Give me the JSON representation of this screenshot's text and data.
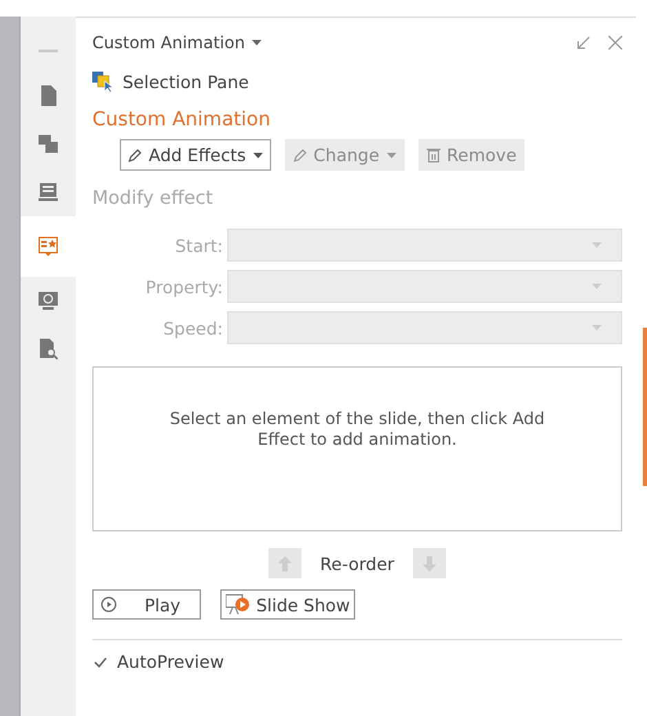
{
  "sidebar": {
    "items": [
      {
        "kind": "menu",
        "selected": false
      },
      {
        "kind": "page",
        "selected": false
      },
      {
        "kind": "transition",
        "selected": false
      },
      {
        "kind": "layout",
        "selected": false
      },
      {
        "kind": "animation",
        "selected": true
      },
      {
        "kind": "switch",
        "selected": false
      },
      {
        "kind": "search",
        "selected": false
      }
    ]
  },
  "pane": {
    "title": "Custom Animation",
    "link": "Selection Pane",
    "heading": "Custom Animation",
    "buttons": [
      {
        "label": "Add Effects",
        "disabled": false,
        "kind": "pencil"
      },
      {
        "label": "Change",
        "disabled": true,
        "kind": "pencil"
      },
      {
        "label": "Remove",
        "disabled": true,
        "kind": "trash"
      }
    ],
    "modify_label": "Modify effect",
    "fields": [
      {
        "label": "Start:",
        "disabled": true
      },
      {
        "label": "Property:",
        "disabled": true
      },
      {
        "label": "Speed:",
        "disabled": true
      }
    ],
    "message": "Select an element of the slide, then click Add Effect to add animation.",
    "reorder": {
      "label": "Re-order",
      "disabled": true
    },
    "play": "Play",
    "slide_show": "Slide Show",
    "autopreview": {
      "label": "AutoPreview",
      "checked": true
    }
  }
}
